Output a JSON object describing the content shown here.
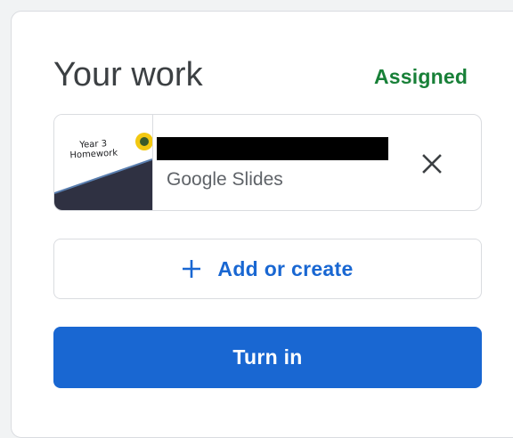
{
  "panel": {
    "title": "Your work",
    "status": "Assigned"
  },
  "attachment": {
    "thumbnail_text": "Year 3\nHomework",
    "type_label": "Google Slides",
    "remove_icon": "close-icon"
  },
  "actions": {
    "add_label": "Add or create",
    "add_icon": "plus-icon",
    "turn_in_label": "Turn in"
  },
  "colors": {
    "status": "#188038",
    "accent": "#1967d2",
    "thumbnail_band": "#2f3142",
    "badge": "#f2c811"
  }
}
